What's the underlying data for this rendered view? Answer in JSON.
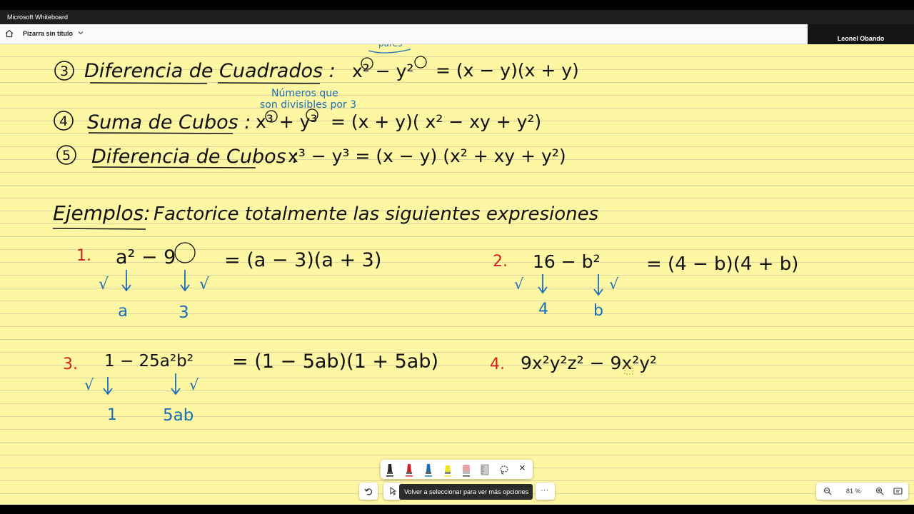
{
  "app": {
    "window_title": "Microsoft Whiteboard"
  },
  "header": {
    "board_title": "Pizarra sin título"
  },
  "participant": {
    "name": "Leonel Obando"
  },
  "whiteboard": {
    "annotation_pares": "pares",
    "rule3": {
      "number": "3",
      "title": "Diferencia de Cuadrados :",
      "formula_lhs": "x² − y²",
      "formula_rhs": "= (x − y)(x + y)"
    },
    "annotation_numeros": "Números que",
    "annotation_divisibles": "son divisibles por 3",
    "rule4": {
      "number": "4",
      "title": "Suma de Cubos :",
      "formula_lhs": "x³ + y³",
      "formula_rhs": "= (x + y)( x² − xy + y²)"
    },
    "rule5": {
      "number": "5",
      "title": "Diferencia de Cubos :",
      "formula": "x³ − y³ = (x − y) (x² + xy + y²)"
    },
    "examples_heading": "Ejemplos:",
    "examples_instruction": "Factorice totalmente las siguientes expresiones",
    "ex1": {
      "num": "1.",
      "expr": "a² − 9",
      "result": "= (a − 3)(a + 3)",
      "root_a": "a",
      "root_b": "3"
    },
    "ex2": {
      "num": "2.",
      "expr": "16 − b²",
      "result": "= (4 − b)(4 + b)",
      "root_a": "4",
      "root_b": "b"
    },
    "ex3": {
      "num": "3.",
      "expr": "1 − 25a²b²",
      "result": "= (1 − 5ab)(1 + 5ab)",
      "root_a": "1",
      "root_b": "5ab"
    },
    "ex4": {
      "num": "4.",
      "expr": "9x²y²z² − 9x²y²"
    },
    "root_symbol": "√"
  },
  "toolbar": {
    "pens": [
      "black-pen",
      "red-pen",
      "blue-pen",
      "yellow-highlighter",
      "eraser",
      "ruler",
      "lasso"
    ],
    "close_label": "×"
  },
  "bottom": {
    "tooltip": "Volver a seleccionar para ver más opciones",
    "more_label": "···"
  },
  "zoom": {
    "value": "81 %"
  },
  "colors": {
    "ink_black": "#111111",
    "ink_red": "#d42020",
    "ink_blue": "#1a6fb8",
    "paper": "#fdf6a3"
  }
}
